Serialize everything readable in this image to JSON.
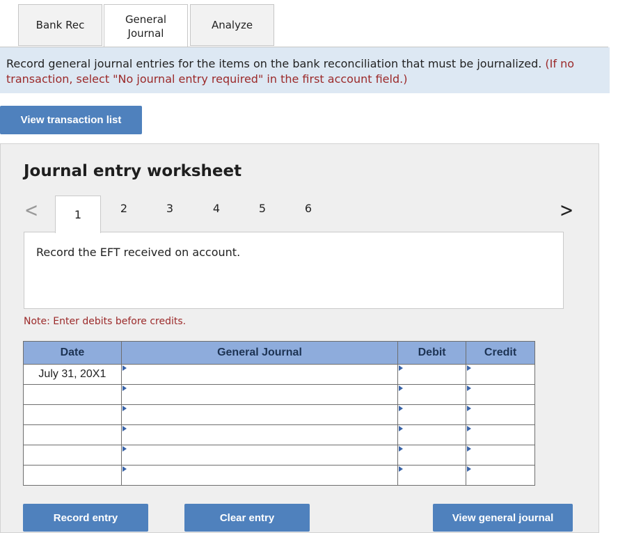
{
  "tabs": [
    {
      "label": "Bank Rec"
    },
    {
      "label": "General\nJournal"
    },
    {
      "label": "Analyze"
    }
  ],
  "instructions": {
    "main": "Record general journal entries for the items on the bank reconciliation that must be journalized.",
    "red_1": "(If no",
    "red_2": "transaction, select \"No journal entry required\" in the first account field.)"
  },
  "buttons": {
    "view_transaction_list": "View transaction list",
    "record_entry": "Record entry",
    "clear_entry": "Clear entry",
    "view_general_journal": "View general journal"
  },
  "worksheet": {
    "title": "Journal entry worksheet",
    "steps": [
      "1",
      "2",
      "3",
      "4",
      "5",
      "6"
    ],
    "active_step": "1",
    "description": "Record the EFT received on account.",
    "note": "Note: Enter debits before credits."
  },
  "table": {
    "headers": {
      "date": "Date",
      "account": "General Journal",
      "debit": "Debit",
      "credit": "Credit"
    },
    "rows": [
      {
        "date": "July 31, 20X1",
        "account": "",
        "debit": "",
        "credit": ""
      },
      {
        "date": "",
        "account": "",
        "debit": "",
        "credit": ""
      },
      {
        "date": "",
        "account": "",
        "debit": "",
        "credit": ""
      },
      {
        "date": "",
        "account": "",
        "debit": "",
        "credit": ""
      },
      {
        "date": "",
        "account": "",
        "debit": "",
        "credit": ""
      },
      {
        "date": "",
        "account": "",
        "debit": "",
        "credit": ""
      }
    ]
  },
  "colors": {
    "accent_blue": "#4f81bd",
    "header_blue": "#8eacdc",
    "instruction_bg": "#dde8f3",
    "note_red": "#9b2929"
  }
}
